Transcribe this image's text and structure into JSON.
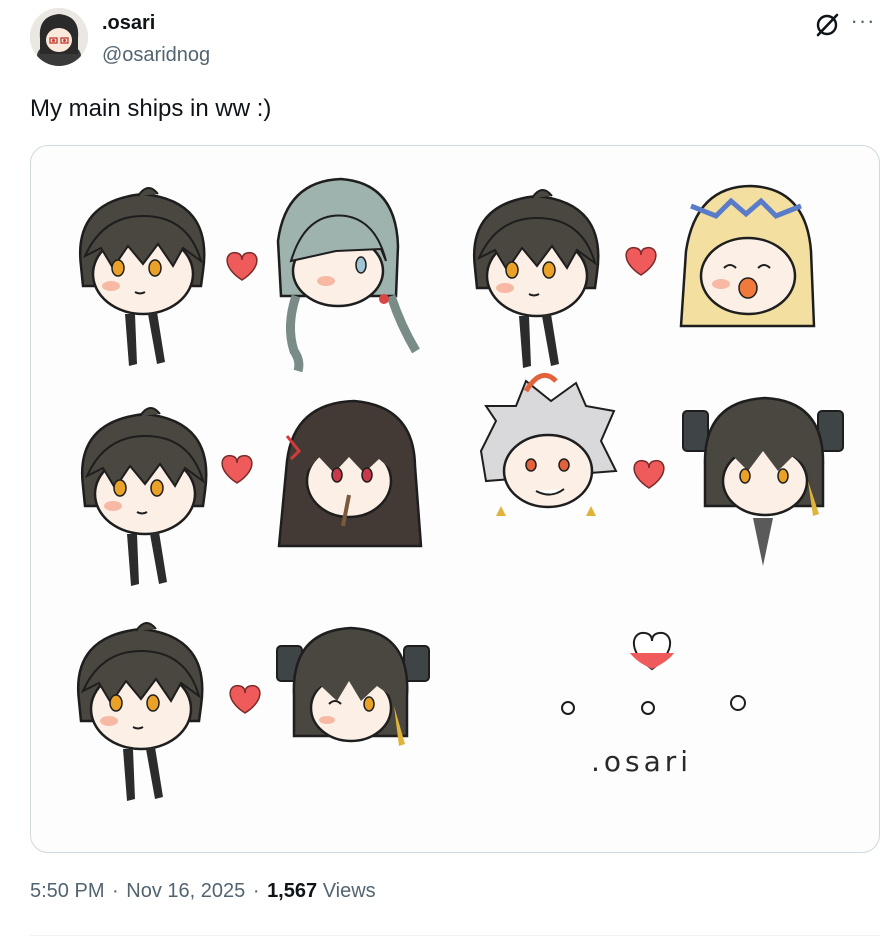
{
  "author": {
    "display_name": ".osari",
    "handle": "@osaridnog"
  },
  "tweet": {
    "text": "My main ships in ww :)",
    "time": "5:50 PM",
    "separator": "·",
    "date": "Nov 16, 2025",
    "views_count": "1,567",
    "views_label": "Views"
  },
  "icons": {
    "avatar": "avatar-image",
    "grok": "grok-icon",
    "more": "more-options-icon"
  },
  "artwork": {
    "signature": ".osari"
  }
}
